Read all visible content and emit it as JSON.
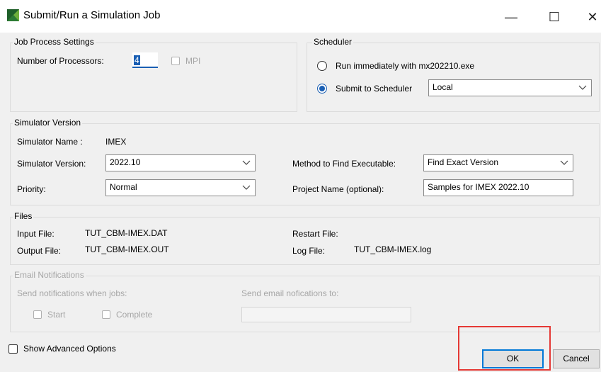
{
  "window": {
    "title": "Submit/Run a Simulation Job",
    "minimize_glyph": "—",
    "maximize_glyph": "☐",
    "close_glyph": "✕"
  },
  "job_process": {
    "legend": "Job Process Settings",
    "processors_label": "Number of Processors:",
    "processors_value": "4",
    "mpi_label": "MPI"
  },
  "scheduler": {
    "legend": "Scheduler",
    "run_immediately_label": "Run immediately with mx202210.exe",
    "submit_label": "Submit to Scheduler",
    "scheduler_value": "Local",
    "selected": "submit"
  },
  "simulator": {
    "legend": "Simulator Version",
    "name_label": "Simulator Name :",
    "name_value": "IMEX",
    "version_label": "Simulator Version:",
    "version_value": "2022.10",
    "priority_label": "Priority:",
    "priority_value": "Normal",
    "method_label": "Method to Find Executable:",
    "method_value": "Find Exact Version",
    "project_label": "Project Name (optional):",
    "project_value": "Samples for IMEX 2022.10"
  },
  "files": {
    "legend": "Files",
    "input_label": "Input File:",
    "input_value": "TUT_CBM-IMEX.DAT",
    "output_label": "Output File:",
    "output_value": "TUT_CBM-IMEX.OUT",
    "restart_label": "Restart File:",
    "restart_value": "",
    "log_label": "Log File:",
    "log_value": "TUT_CBM-IMEX.log"
  },
  "email": {
    "legend": "Email Notifications",
    "when_label": "Send notifications when jobs:",
    "to_label": "Send email nofications to:",
    "start_label": "Start",
    "complete_label": "Complete",
    "address_value": ""
  },
  "footer": {
    "advanced_label": "Show Advanced Options",
    "ok_label": "OK",
    "cancel_label": "Cancel"
  },
  "colors": {
    "accent": "#1a5fb4",
    "highlight": "#e53935",
    "disabled_text": "#a6a6a6"
  },
  "icons": {
    "app": "simulator-app-icon",
    "dropdown": "chevron-down-icon"
  }
}
